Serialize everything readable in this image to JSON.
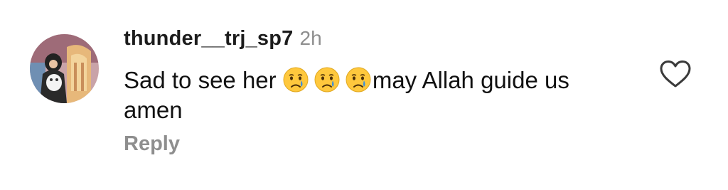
{
  "comment": {
    "username": "thunder__trj_sp7",
    "time": "2h",
    "text_start": "Sad to see her ",
    "emojis": [
      "crying-face-emoji",
      "crying-face-emoji",
      "crying-face-emoji"
    ],
    "text_end": "may Allah guide us amen",
    "reply_label": "Reply",
    "like_icon": "heart-outline-icon"
  },
  "colors": {
    "username": "#1c1c1c",
    "secondary": "#8e8e8e",
    "text": "#111111",
    "emoji_face": "#ffc83d",
    "emoji_tear": "#3b8fe0"
  }
}
